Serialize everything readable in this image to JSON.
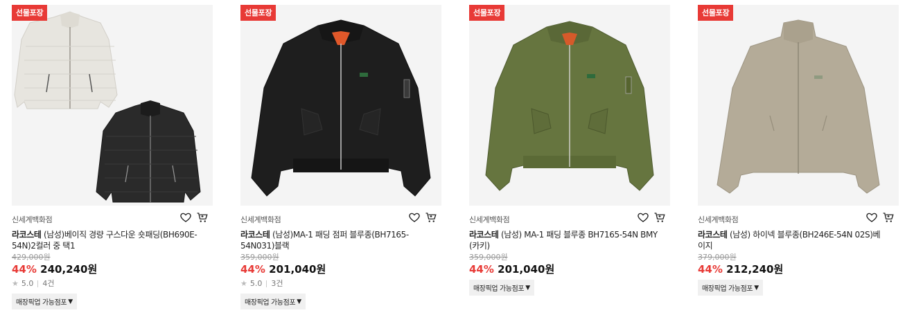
{
  "colors": {
    "accent": "#e83a36",
    "badge_bg": "#e83a36"
  },
  "products": [
    {
      "badge": "선물포장",
      "store": "신세계백화점",
      "brand": "라코스테",
      "name": "(남성)베이직 경량 구스다운 숏패딩(BH690E-54N)2컬러 중 택1",
      "original_price": "429,000원",
      "discount": "44%",
      "price": "240,240원",
      "rating": "5.0",
      "reviews": "4건",
      "pickup": "매장픽업 가능점포",
      "image": "two puffer down jackets, cream and black"
    },
    {
      "badge": "선물포장",
      "store": "신세계백화점",
      "brand": "라코스테",
      "name": "(남성)MA-1 패딩 점퍼 블루종(BH7165-54N031)블랙",
      "original_price": "359,000원",
      "discount": "44%",
      "price": "201,040원",
      "rating": "5.0",
      "reviews": "3건",
      "pickup": "매장픽업 가능점포",
      "image": "black MA-1 bomber jacket"
    },
    {
      "badge": "선물포장",
      "store": "신세계백화점",
      "brand": "라코스테",
      "name": "(남성) MA-1 패딩 블루종 BH7165-54N BMY (카키)",
      "original_price": "359,000원",
      "discount": "44%",
      "price": "201,040원",
      "rating": null,
      "reviews": null,
      "pickup": "매장픽업 가능점포",
      "image": "khaki MA-1 bomber jacket"
    },
    {
      "badge": "선물포장",
      "store": "신세계백화점",
      "brand": "라코스테",
      "name": "(남성) 하이넥 블루종(BH246E-54N 02S)베이지",
      "original_price": "379,000원",
      "discount": "44%",
      "price": "212,240원",
      "rating": null,
      "reviews": null,
      "pickup": "매장픽업 가능점포",
      "image": "beige high-neck blouson"
    }
  ]
}
